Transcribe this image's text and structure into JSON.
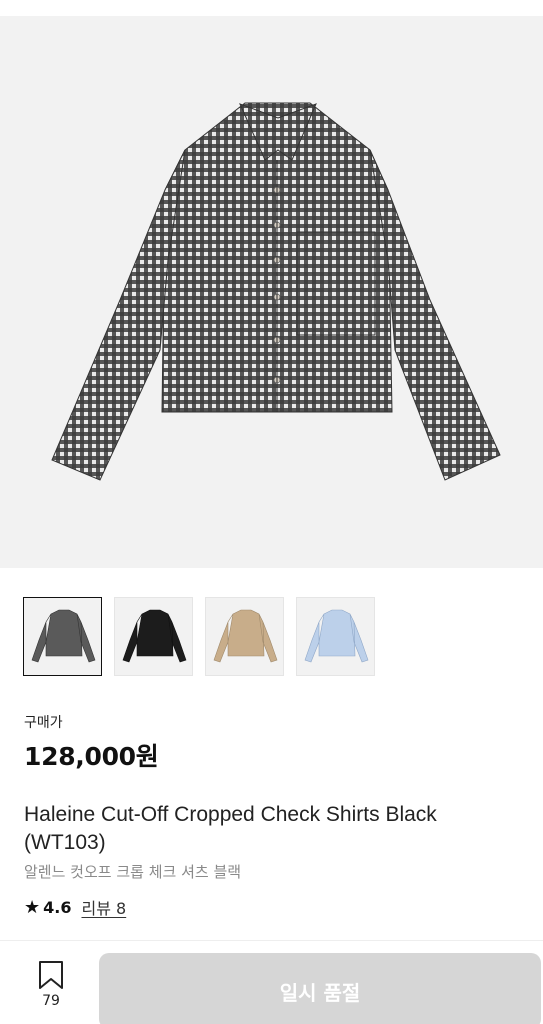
{
  "product": {
    "main_image_icon": "checked-cropped-shirt-image",
    "thumbnails": [
      {
        "color_name": "black check",
        "color": "#5a5a5a",
        "selected": true
      },
      {
        "color_name": "black",
        "color": "#1c1c1c",
        "selected": false
      },
      {
        "color_name": "beige",
        "color": "#c8ad8a",
        "selected": false
      },
      {
        "color_name": "light blue",
        "color": "#bcd0ea",
        "selected": false
      }
    ],
    "price_label": "구매가",
    "price": "128,000원",
    "title": "Haleine Cut-Off Cropped Check Shirts Black (WT103)",
    "subtitle": "알렌느 컷오프 크롭 체크 셔츠 블랙",
    "rating_star_icon": "star-icon",
    "rating_value": "4.6",
    "review_link": "리뷰 8"
  },
  "footer": {
    "bookmark_icon": "bookmark-icon",
    "bookmark_count": "79",
    "soldout_label": "일시 품절"
  }
}
